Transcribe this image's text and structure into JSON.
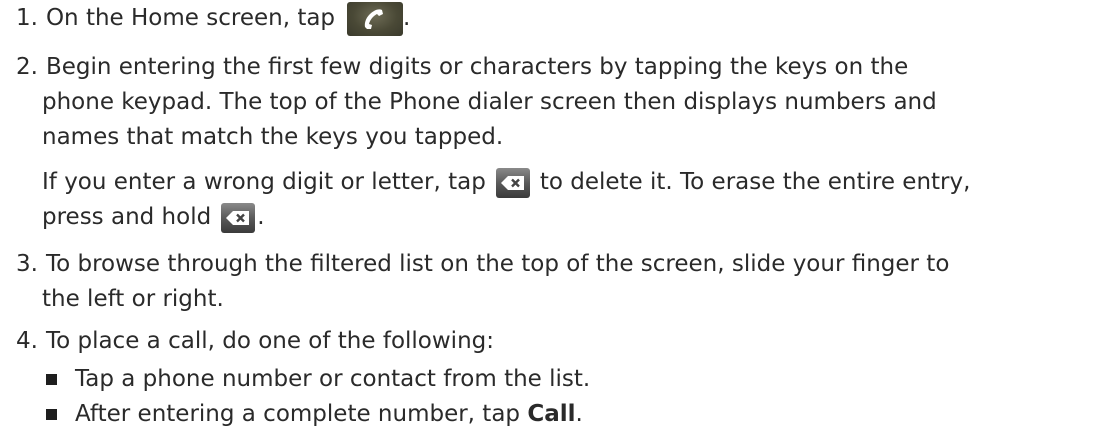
{
  "steps": [
    {
      "number": "1.",
      "lines": [
        "On the Home screen, tap"
      ],
      "trail": "."
    },
    {
      "number": "2.",
      "lines": [
        "Begin entering the first few digits or characters by tapping the keys on the",
        "phone keypad. The top of the Phone dialer screen then displays numbers and",
        "names that match the keys you tapped."
      ],
      "note_a1": "If you enter a wrong digit or letter, tap",
      "note_a2": "to delete it. To erase the entire entry,",
      "note_b1": "press and hold",
      "note_b2": "."
    },
    {
      "number": "3.",
      "lines": [
        "To browse through the filtered list on the top of the screen, slide your finger to",
        "the left or right."
      ]
    },
    {
      "number": "4.",
      "lines": [
        "To place a call, do one of the following:"
      ],
      "bullets": [
        {
          "text": "Tap a phone number or contact from the list."
        },
        {
          "text_before": "After entering a complete number, tap ",
          "bold": "Call",
          "text_after": "."
        }
      ]
    }
  ],
  "icons": {
    "phone": "phone-handset-icon",
    "delete": "backspace-delete-icon"
  }
}
